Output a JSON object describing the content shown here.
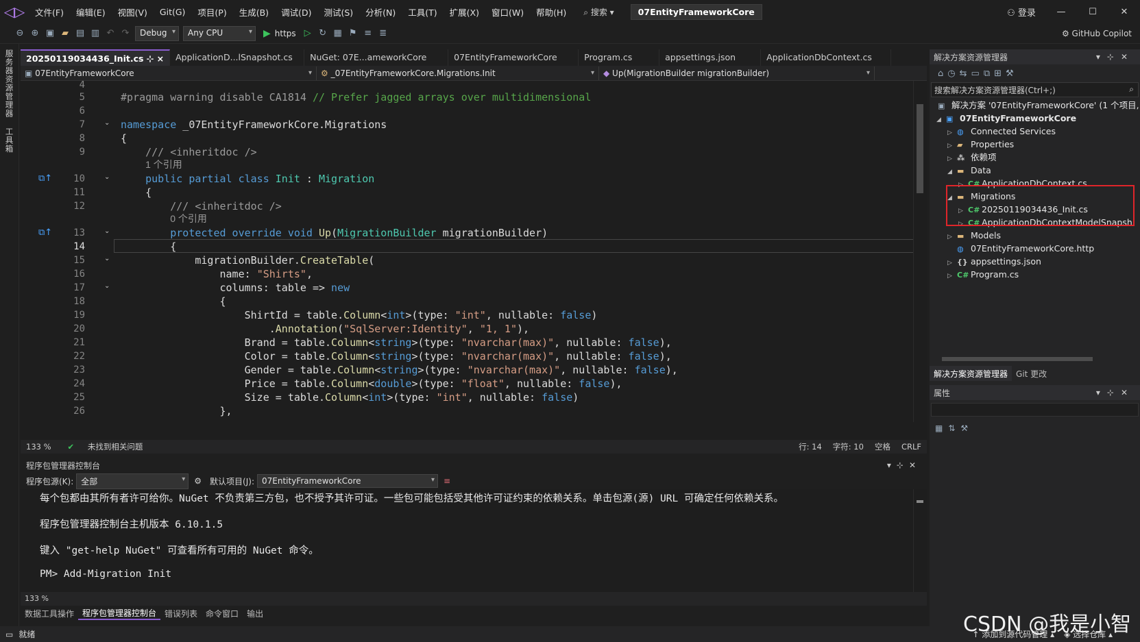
{
  "menubar": {
    "logo": "◁▷",
    "items": [
      "文件(F)",
      "编辑(E)",
      "视图(V)",
      "Git(G)",
      "项目(P)",
      "生成(B)",
      "调试(D)",
      "测试(S)",
      "分析(N)",
      "工具(T)",
      "扩展(X)",
      "窗口(W)",
      "帮助(H)"
    ],
    "search": "搜索",
    "solution_title": "07EntityFrameworkCore",
    "login": "登录",
    "minimize": "—",
    "maximize": "☐",
    "close": "✕"
  },
  "toolbar": {
    "config": "Debug",
    "platform": "Any CPU",
    "run_target": "https",
    "copilot": "GitHub Copilot"
  },
  "leftstrip": {
    "server_explorer": "服务器资源管理器",
    "toolbox": "工具箱"
  },
  "tabs": [
    {
      "label": "20250119034436_Init.cs",
      "pin": "⊹",
      "close": "×"
    },
    {
      "label": "ApplicationD...lSnapshot.cs"
    },
    {
      "label": "NuGet: 07E...ameworkCore"
    },
    {
      "label": "07EntityFrameworkCore"
    },
    {
      "label": "Program.cs"
    },
    {
      "label": "appsettings.json"
    },
    {
      "label": "ApplicationDbContext.cs"
    }
  ],
  "navbar": {
    "project": "07EntityFrameworkCore",
    "type": "_07EntityFrameworkCore.Migrations.Init",
    "member": "Up(MigrationBuilder migrationBuilder)"
  },
  "editor": {
    "line_numbers": [
      "4",
      "5",
      "6",
      "7",
      "8",
      "9",
      "",
      "10",
      "11",
      "12",
      "",
      "13",
      "14",
      "15",
      "16",
      "17",
      "18",
      "19",
      "20",
      "21",
      "22",
      "23",
      "24",
      "25",
      "26"
    ],
    "current_line": "14",
    "refs_1": "1 个引用",
    "refs_0": "0 个引用"
  },
  "editor_status": {
    "zoom": "133 %",
    "issues": "未找到相关问题",
    "line": "行: 14",
    "col": "字符: 10",
    "spaces": "空格",
    "eol": "CRLF"
  },
  "console": {
    "title": "程序包管理器控制台",
    "source_label": "程序包源(K):",
    "source_value": "全部",
    "project_label": "默认项目(J):",
    "project_value": "07EntityFrameworkCore",
    "lines": [
      "每个包都由其所有者许可给你。NuGet 不负责第三方包，也不授予其许可证。一些包可能包括受其他许可证约束的依赖关系。单击包源(源) URL 可确定任何依赖关系。",
      "程序包管理器控制台主机版本 6.10.1.5",
      "键入 \"get-help NuGet\" 可查看所有可用的 NuGet 命令。",
      "PM> Add-Migration Init"
    ],
    "zoom": "133 %"
  },
  "bottom_tabs": [
    "数据工具操作",
    "程序包管理器控制台",
    "错误列表",
    "命令窗口",
    "输出"
  ],
  "statusbar": {
    "ready": "就绪",
    "add_source": "添加到源代码管理",
    "select_repo": "选择仓库"
  },
  "solution_explorer": {
    "title": "解决方案资源管理器",
    "search_placeholder": "搜索解决方案资源管理器(Ctrl+;)",
    "items": [
      {
        "label": "解决方案 '07EntityFrameworkCore' (1 个项目,",
        "icon": "solution-icon"
      },
      {
        "label": "07EntityFrameworkCore",
        "icon": "csproj-icon"
      },
      {
        "label": "Connected Services",
        "icon": "connected-services-icon"
      },
      {
        "label": "Properties",
        "icon": "properties-icon"
      },
      {
        "label": "依赖项",
        "icon": "dependencies-icon"
      },
      {
        "label": "Data",
        "icon": "folder-icon"
      },
      {
        "label": "ApplicationDbContext.cs",
        "icon": "csharp-file-icon"
      },
      {
        "label": "Migrations",
        "icon": "folder-icon"
      },
      {
        "label": "20250119034436_Init.cs",
        "icon": "csharp-file-icon"
      },
      {
        "label": "ApplicationDbContextModelSnapsh",
        "icon": "csharp-file-icon"
      },
      {
        "label": "Models",
        "icon": "folder-icon"
      },
      {
        "label": "07EntityFrameworkCore.http",
        "icon": "http-file-icon"
      },
      {
        "label": "appsettings.json",
        "icon": "json-file-icon"
      },
      {
        "label": "Program.cs",
        "icon": "csharp-file-icon"
      }
    ],
    "tabs": [
      "解决方案资源管理器",
      "Git 更改"
    ],
    "highlight_color": "#e0252a"
  },
  "properties": {
    "title": "属性"
  },
  "watermark": "CSDN @我是小智"
}
